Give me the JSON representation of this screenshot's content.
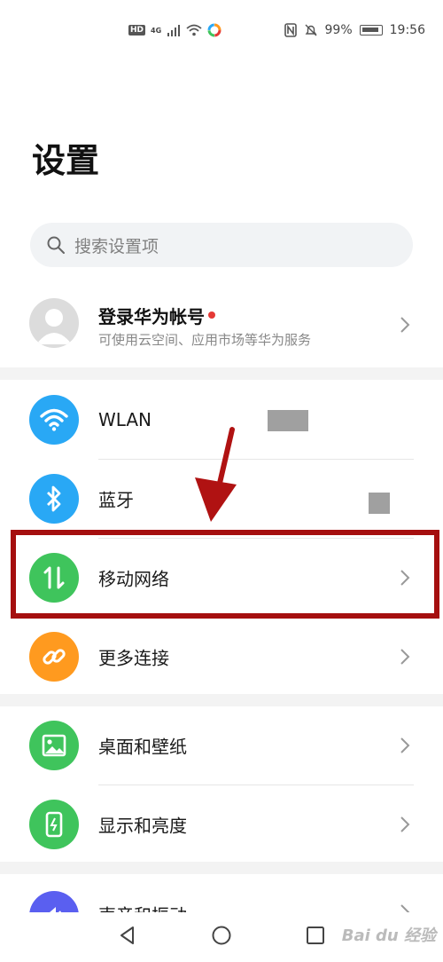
{
  "status_bar": {
    "hd": "HD",
    "network": "4G",
    "battery": "99%",
    "time": "19:56"
  },
  "header": {
    "title": "设置"
  },
  "search": {
    "placeholder": "搜索设置项"
  },
  "account": {
    "title": "登录华为帐号",
    "subtitle": "可使用云空间、应用市场等华为服务"
  },
  "groups": [
    {
      "items": [
        {
          "label": "WLAN",
          "icon": "wifi-icon",
          "color": "#29a8f5"
        },
        {
          "label": "蓝牙",
          "icon": "bluetooth-icon",
          "color": "#29a8f5"
        },
        {
          "label": "移动网络",
          "icon": "mobile-data-icon",
          "color": "#3fc45c"
        },
        {
          "label": "更多连接",
          "icon": "link-icon",
          "color": "#ff9a1f"
        }
      ]
    },
    {
      "items": [
        {
          "label": "桌面和壁纸",
          "icon": "wallpaper-icon",
          "color": "#3fc45c"
        },
        {
          "label": "显示和亮度",
          "icon": "display-icon",
          "color": "#3fc45c"
        }
      ]
    },
    {
      "items": [
        {
          "label": "声音和振动",
          "icon": "sound-icon",
          "color": "#5a5ff0"
        }
      ]
    }
  ],
  "watermark": "Bai du 经验",
  "colors": {
    "highlight": "#a50f0f",
    "accent_red": "#e53935"
  }
}
